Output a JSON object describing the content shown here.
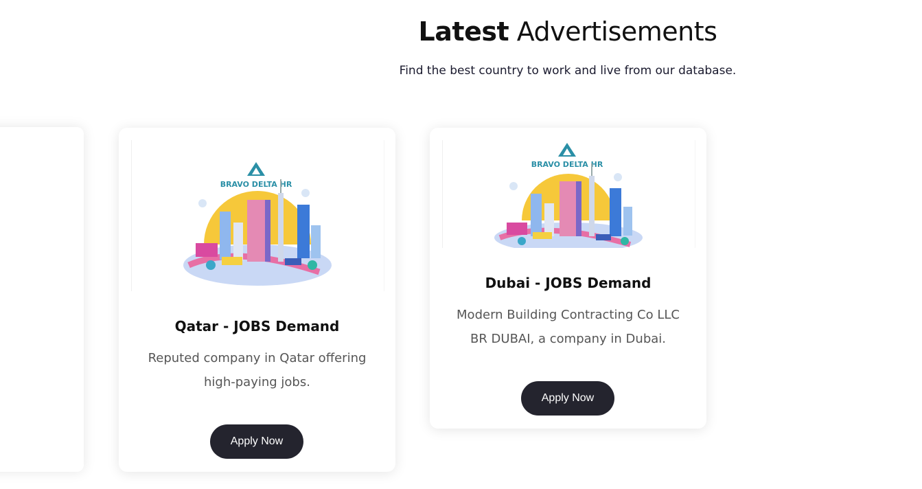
{
  "header": {
    "title_bold": "Latest",
    "title_rest": " Advertisements",
    "subtitle": "Find the best country to work and live from our database."
  },
  "cards": [
    {
      "logo_text": "BRAVO DELTA HR",
      "title": "Qatar - JOBS Demand",
      "description": "Reputed company in Qatar offering high-paying jobs.",
      "button_label": "Apply Now"
    },
    {
      "logo_text": "BRAVO DELTA HR",
      "title": "Dubai - JOBS Demand",
      "description": "Modern Building Contracting Co LLC BR DUBAI, a company in Dubai.",
      "button_label": "Apply Now"
    }
  ],
  "colors": {
    "button_bg": "#24242e",
    "logo_teal": "#2a8fa6",
    "sun_yellow": "#f6c83a"
  }
}
